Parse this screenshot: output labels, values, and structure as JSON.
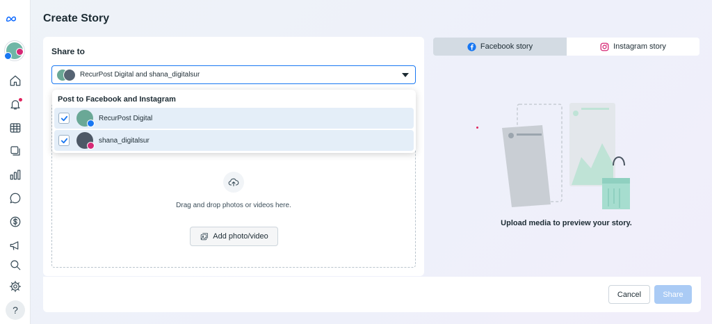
{
  "page": {
    "title": "Create Story"
  },
  "share": {
    "label": "Share to",
    "selected_text": "RecurPost Digital and shana_digitalsur"
  },
  "dropdown": {
    "title": "Post to Facebook and Instagram",
    "accounts": [
      {
        "name": "RecurPost Digital",
        "checked": true,
        "platform": "facebook"
      },
      {
        "name": "shana_digitalsur",
        "checked": true,
        "platform": "instagram"
      }
    ]
  },
  "upload": {
    "drop_text": "Drag and drop photos or videos here.",
    "add_button": "Add photo/video"
  },
  "preview": {
    "tabs": [
      {
        "label": "Facebook story",
        "active": true
      },
      {
        "label": "Instagram story",
        "active": false
      }
    ],
    "caption": "Upload media to preview your story."
  },
  "footer": {
    "cancel": "Cancel",
    "share": "Share"
  },
  "sidebar": {
    "icons": [
      "home-icon",
      "bell-icon",
      "table-icon",
      "layers-icon",
      "chart-icon",
      "chat-icon",
      "dollar-icon",
      "megaphone-icon",
      "search-icon",
      "gear-icon"
    ],
    "help_label": "?"
  },
  "colors": {
    "accent": "#1877f2",
    "facebook": "#1877f2",
    "instagram": "#d62976",
    "share_disabled": "#aacbf5"
  }
}
